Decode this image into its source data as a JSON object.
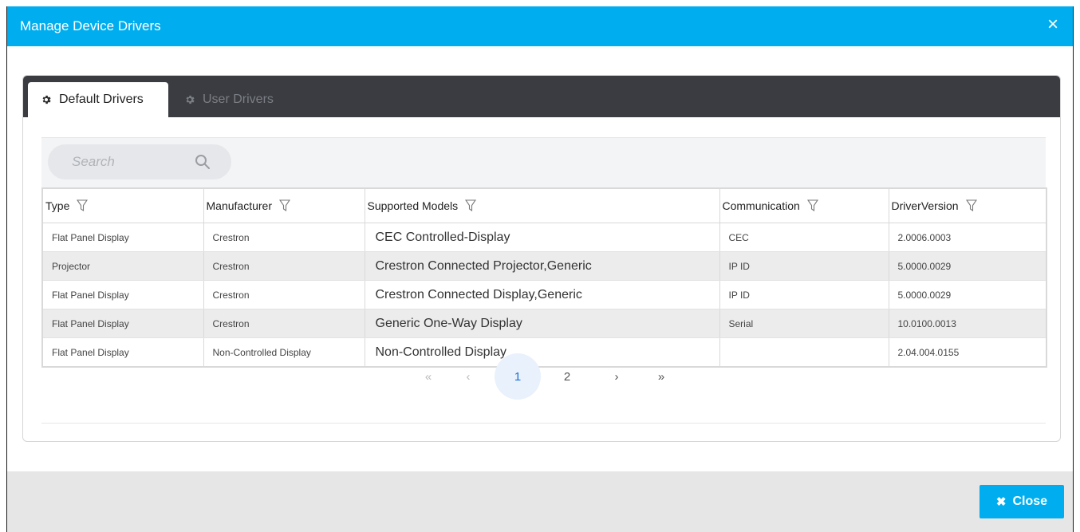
{
  "dialog": {
    "title": "Manage Device Drivers",
    "close_icon": "×"
  },
  "tabs": [
    {
      "label": "Default Drivers",
      "icon": "gear-icon",
      "active": true
    },
    {
      "label": "User Drivers",
      "icon": "gear-icon",
      "active": false
    }
  ],
  "search": {
    "placeholder": "Search",
    "value": ""
  },
  "table": {
    "columns": [
      "Type",
      "Manufacturer",
      "Supported Models",
      "Communication",
      "DriverVersion"
    ],
    "rows": [
      {
        "type": "Flat Panel Display",
        "manufacturer": "Crestron",
        "models": "CEC Controlled-Display",
        "communication": "CEC",
        "version": "2.0006.0003"
      },
      {
        "type": "Projector",
        "manufacturer": "Crestron",
        "models": "Crestron Connected Projector,Generic",
        "communication": "IP ID",
        "version": "5.0000.0029"
      },
      {
        "type": "Flat Panel Display",
        "manufacturer": "Crestron",
        "models": "Crestron Connected Display,Generic",
        "communication": "IP ID",
        "version": "5.0000.0029"
      },
      {
        "type": "Flat Panel Display",
        "manufacturer": "Crestron",
        "models": "Generic One-Way Display",
        "communication": "Serial",
        "version": "10.0100.0013"
      },
      {
        "type": "Flat Panel Display",
        "manufacturer": "Non-Controlled Display",
        "models": "Non-Controlled Display",
        "communication": "",
        "version": "2.04.004.0155"
      }
    ]
  },
  "pagination": {
    "first": "«",
    "prev": "‹",
    "pages": [
      "1",
      "2"
    ],
    "current_page": "1",
    "next": "›",
    "last": "»"
  },
  "footer": {
    "close_label": "Close",
    "close_icon": "times-icon"
  },
  "colors": {
    "accent": "#00aeef",
    "tab_bar": "#3a3c41",
    "footer": "#e6e6e6",
    "current_page_bg": "#e8f1fc",
    "current_page_text": "#1d6fd6"
  }
}
